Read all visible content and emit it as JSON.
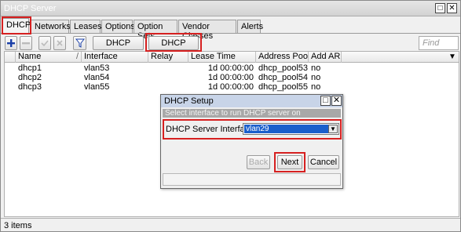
{
  "window": {
    "title": "DHCP Server"
  },
  "tabs": [
    {
      "label": "DHCP"
    },
    {
      "label": "Networks"
    },
    {
      "label": "Leases"
    },
    {
      "label": "Options"
    },
    {
      "label": "Option Sets"
    },
    {
      "label": "Vendor Classes"
    },
    {
      "label": "Alerts"
    }
  ],
  "toolbar": {
    "dhcp_config_label": "DHCP Config",
    "dhcp_setup_label": "DHCP Setup",
    "find_placeholder": "Find",
    "icons": [
      "plus-icon",
      "minus-icon",
      "check-icon",
      "cross-icon",
      "filter-icon"
    ]
  },
  "table": {
    "columns": [
      "Name",
      "Interface",
      "Relay",
      "Lease Time",
      "Address Pool",
      "Add AR..."
    ],
    "rows": [
      {
        "name": "dhcp1",
        "interface": "vlan53",
        "relay": "",
        "lease_time": "1d 00:00:00",
        "address_pool": "dhcp_pool53",
        "add_arp": "no"
      },
      {
        "name": "dhcp2",
        "interface": "vlan54",
        "relay": "",
        "lease_time": "1d 00:00:00",
        "address_pool": "dhcp_pool54",
        "add_arp": "no"
      },
      {
        "name": "dhcp3",
        "interface": "vlan55",
        "relay": "",
        "lease_time": "1d 00:00:00",
        "address_pool": "dhcp_pool55",
        "add_arp": "no"
      }
    ]
  },
  "status": {
    "items_text": "3 items"
  },
  "dialog": {
    "title": "DHCP Setup",
    "info": "Select interface to run DHCP server on",
    "field_label": "DHCP Server Interface:",
    "field_value": "vlan29",
    "back_label": "Back",
    "next_label": "Next",
    "cancel_label": "Cancel"
  },
  "colors": {
    "highlight": "#d62020",
    "selection": "#1a5fcc",
    "accent_blue": "#1a3fa8"
  }
}
